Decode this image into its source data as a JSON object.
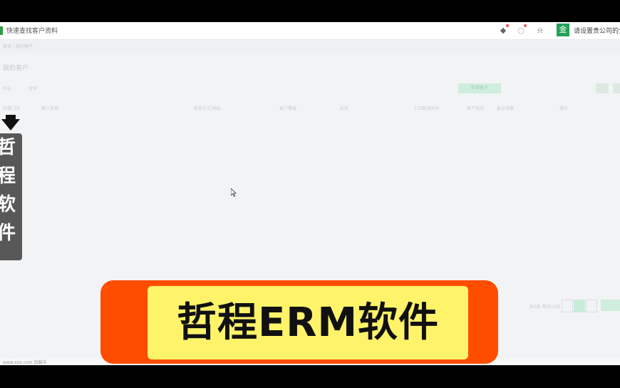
{
  "header": {
    "app_title": "快速查找客户资料",
    "company_name": "请设置贵公司的全称",
    "icons": [
      "android-icon",
      "chat-icon",
      "bell-icon"
    ],
    "company_logo": "金"
  },
  "breadcrumb": "首页 / 我的客户",
  "page_title": "我的客户",
  "filters": [
    "筛选",
    "搜索"
  ],
  "action_button": "新增客户",
  "table_columns": [
    "所属门店",
    "客户名称",
    "联系方式/地址",
    "客户等级",
    "标签",
    "上次跟进时间",
    "客户状态",
    "最近消费",
    "操作"
  ],
  "pager": {
    "summary": "共0条 每页10条",
    "current_page": "1",
    "next_label": "前往"
  },
  "side_label": [
    "哲",
    "程",
    "软",
    "件"
  ],
  "banner_text": "哲程ERM软件",
  "status_text": "www.xxx.com 加载中",
  "colors": {
    "brand_green": "#22a157",
    "banner_orange": "#ff4d00",
    "banner_yellow": "#fff36a"
  }
}
